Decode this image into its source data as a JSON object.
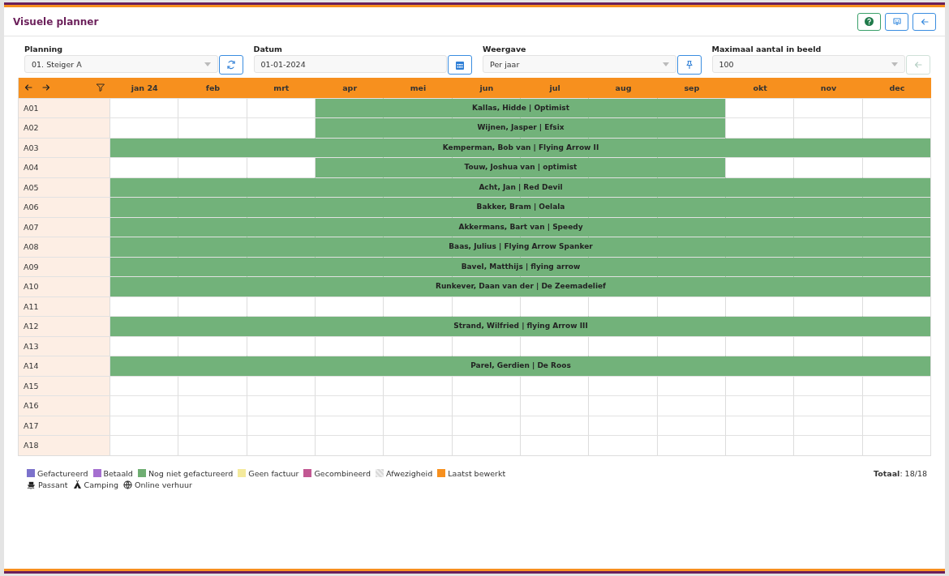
{
  "title": "Visuele planner",
  "header_buttons": [
    {
      "kind": "help"
    },
    {
      "kind": "chat"
    },
    {
      "kind": "back"
    }
  ],
  "filters": [
    {
      "label": "Planning",
      "value": "01. Steiger A",
      "kind": "select",
      "button": {
        "kind": "refresh",
        "disabled": false
      }
    },
    {
      "label": "Datum",
      "value": "01-01-2024",
      "kind": "date",
      "button": {
        "kind": "calendar",
        "disabled": false
      }
    },
    {
      "label": "Weergave",
      "value": "Per jaar",
      "kind": "select",
      "button": {
        "kind": "pin",
        "disabled": false
      }
    },
    {
      "label": "Maximaal aantal in beeld",
      "value": "100",
      "kind": "select",
      "button": {
        "kind": "back",
        "disabled": true
      }
    }
  ],
  "months": [
    "jan 24",
    "feb",
    "mrt",
    "apr",
    "mei",
    "jun",
    "jul",
    "aug",
    "sep",
    "okt",
    "nov",
    "dec"
  ],
  "rows": [
    {
      "label": "A01",
      "booking": "Kallas, Hidde | Optimist",
      "occupied": [
        false,
        false,
        false,
        true,
        true,
        true,
        true,
        true,
        true,
        false,
        false,
        false
      ]
    },
    {
      "label": "A02",
      "booking": "Wijnen, Jasper | Efsix",
      "occupied": [
        false,
        false,
        false,
        true,
        true,
        true,
        true,
        true,
        true,
        false,
        false,
        false
      ]
    },
    {
      "label": "A03",
      "booking": "Kemperman, Bob van | Flying Arrow II",
      "occupied": [
        true,
        true,
        true,
        true,
        true,
        true,
        true,
        true,
        true,
        true,
        true,
        true
      ]
    },
    {
      "label": "A04",
      "booking": "Touw, Joshua van | optimist",
      "occupied": [
        false,
        false,
        false,
        true,
        true,
        true,
        true,
        true,
        true,
        false,
        false,
        false
      ]
    },
    {
      "label": "A05",
      "booking": "Acht, Jan | Red Devil",
      "occupied": [
        true,
        true,
        true,
        true,
        true,
        true,
        true,
        true,
        true,
        true,
        true,
        true
      ]
    },
    {
      "label": "A06",
      "booking": "Bakker, Bram | Oelala",
      "occupied": [
        true,
        true,
        true,
        true,
        true,
        true,
        true,
        true,
        true,
        true,
        true,
        true
      ]
    },
    {
      "label": "A07",
      "booking": "Akkermans, Bart van | Speedy",
      "occupied": [
        true,
        true,
        true,
        true,
        true,
        true,
        true,
        true,
        true,
        true,
        true,
        true
      ]
    },
    {
      "label": "A08",
      "booking": "Baas, Julius | Flying Arrow Spanker",
      "occupied": [
        true,
        true,
        true,
        true,
        true,
        true,
        true,
        true,
        true,
        true,
        true,
        true
      ]
    },
    {
      "label": "A09",
      "booking": "Bavel, Matthijs | flying arrow",
      "occupied": [
        true,
        true,
        true,
        true,
        true,
        true,
        true,
        true,
        true,
        true,
        true,
        true
      ]
    },
    {
      "label": "A10",
      "booking": "Runkever, Daan van der | De Zeemadelief",
      "occupied": [
        true,
        true,
        true,
        true,
        true,
        true,
        true,
        true,
        true,
        true,
        true,
        true
      ]
    },
    {
      "label": "A11",
      "occupied": [
        false,
        false,
        false,
        false,
        false,
        false,
        false,
        false,
        false,
        false,
        false,
        false
      ]
    },
    {
      "label": "A12",
      "booking": "Strand, Wilfried | flying Arrow III",
      "occupied": [
        true,
        true,
        true,
        true,
        true,
        true,
        true,
        true,
        true,
        true,
        true,
        true
      ]
    },
    {
      "label": "A13",
      "occupied": [
        false,
        false,
        false,
        false,
        false,
        false,
        false,
        false,
        false,
        false,
        false,
        false
      ]
    },
    {
      "label": "A14",
      "booking": "Parel, Gerdien | De Roos",
      "occupied": [
        true,
        true,
        true,
        true,
        true,
        true,
        true,
        true,
        true,
        true,
        true,
        true
      ]
    },
    {
      "label": "A15",
      "occupied": [
        false,
        false,
        false,
        false,
        false,
        false,
        false,
        false,
        false,
        false,
        false,
        false
      ]
    },
    {
      "label": "A16",
      "occupied": [
        false,
        false,
        false,
        false,
        false,
        false,
        false,
        false,
        false,
        false,
        false,
        false
      ]
    },
    {
      "label": "A17",
      "occupied": [
        false,
        false,
        false,
        false,
        false,
        false,
        false,
        false,
        false,
        false,
        false,
        false
      ]
    },
    {
      "label": "A18",
      "occupied": [
        false,
        false,
        false,
        false,
        false,
        false,
        false,
        false,
        false,
        false,
        false,
        false
      ]
    }
  ],
  "legend": [
    {
      "label": "Gefactureerd",
      "kind": "swatch",
      "color": "#7c72cc"
    },
    {
      "label": "Betaald",
      "kind": "swatch",
      "color": "#a56fd0"
    },
    {
      "label": "Nog niet gefactureerd",
      "kind": "swatch",
      "color": "#6fae72"
    },
    {
      "label": "Geen factuur",
      "kind": "swatch",
      "color": "#f4ea9c"
    },
    {
      "label": "Gecombineerd",
      "kind": "swatch",
      "color": "#c25893"
    },
    {
      "label": "Afwezigheid",
      "kind": "hatched",
      "color": "#d9d9d9"
    },
    {
      "label": "Laatst bewerkt",
      "kind": "swatch",
      "color": "#f7901e"
    }
  ],
  "legend_icons": [
    {
      "label": "Passant",
      "kind": "boat"
    },
    {
      "label": "Camping",
      "kind": "tent"
    },
    {
      "label": "Online verhuur",
      "kind": "globe"
    }
  ],
  "total": "**Totaal**: 18/18"
}
